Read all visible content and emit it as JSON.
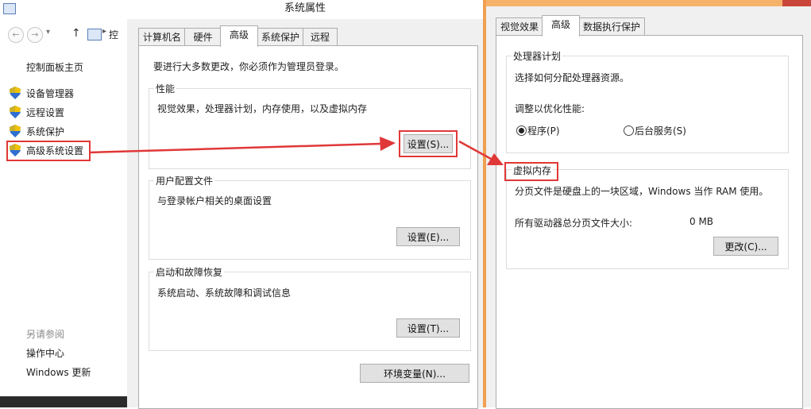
{
  "control_panel": {
    "nav_back": "←",
    "nav_forward": "→",
    "nav_up": "↑",
    "address_text": "控",
    "home_link": "控制面板主页",
    "items": [
      {
        "label": "设备管理器",
        "icon": "shield-icon"
      },
      {
        "label": "远程设置",
        "icon": "shield-icon"
      },
      {
        "label": "系统保护",
        "icon": "shield-icon"
      },
      {
        "label": "高级系统设置",
        "icon": "shield-icon"
      }
    ],
    "see_also": "另请参阅",
    "see_also_links": [
      "操作中心",
      "Windows 更新"
    ]
  },
  "system_properties": {
    "title": "系统属性",
    "tabs": [
      "计算机名",
      "硬件",
      "高级",
      "系统保护",
      "远程"
    ],
    "active_tab": "高级",
    "admin_note": "要进行大多数更改，你必须作为管理员登录。",
    "performance": {
      "title": "性能",
      "desc": "视觉效果，处理器计划，内存使用，以及虚拟内存",
      "button": "设置(S)..."
    },
    "user_profiles": {
      "title": "用户配置文件",
      "desc": "与登录帐户相关的桌面设置",
      "button": "设置(E)..."
    },
    "startup_recovery": {
      "title": "启动和故障恢复",
      "desc": "系统启动、系统故障和调试信息",
      "button": "设置(T)..."
    },
    "env_button": "环境变量(N)..."
  },
  "performance_options": {
    "tabs": [
      "视觉效果",
      "高级",
      "数据执行保护"
    ],
    "active_tab": "高级",
    "processor": {
      "title": "处理器计划",
      "desc": "选择如何分配处理器资源。",
      "adjust_label": "调整以优化性能:",
      "options": [
        "程序(P)",
        "后台服务(S)"
      ],
      "selected": "程序(P)"
    },
    "virtual_memory": {
      "title": "虚拟内存",
      "desc": "分页文件是硬盘上的一块区域，Windows 当作 RAM 使用。",
      "total_label": "所有驱动器总分页文件大小:",
      "total_value": "0 MB",
      "button": "更改(C)..."
    }
  },
  "colors": {
    "highlight": "#e03838",
    "arrow": "#e03838",
    "perf_border": "#f0a050"
  }
}
